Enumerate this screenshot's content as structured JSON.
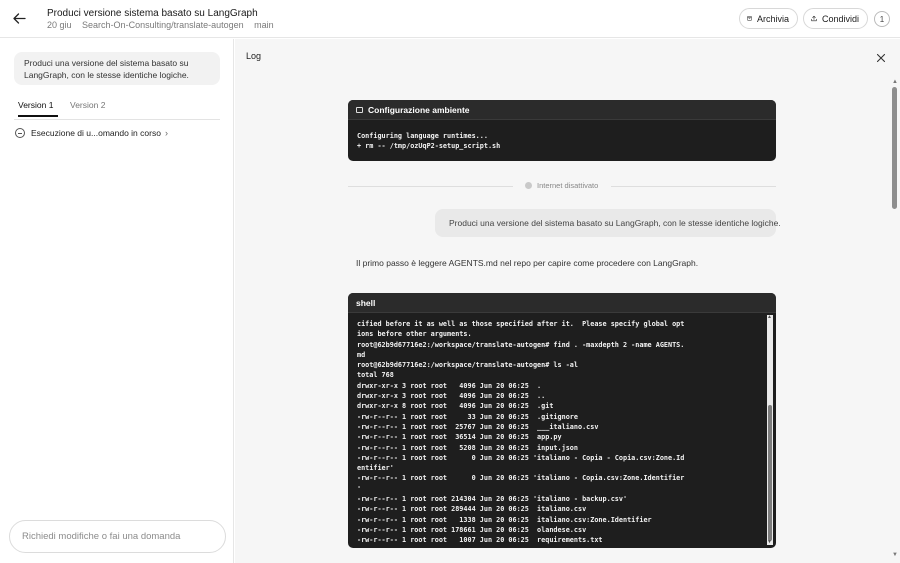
{
  "header": {
    "title": "Produci versione sistema basato su LangGraph",
    "date": "20 giu",
    "repo": "Search-On-Consulting/translate-autogen",
    "branch": "main",
    "archive_label": "Archivia",
    "share_label": "Condividi",
    "more_label": "1"
  },
  "sidebar": {
    "prompt": "Produci una versione del sistema basato su LangGraph, con le stesse identiche logiche.",
    "tabs": [
      {
        "label": "Version 1",
        "active": true
      },
      {
        "label": "Version 2",
        "active": false
      }
    ],
    "task_label": "Esecuzione di u...omando in corso",
    "input_placeholder": "Richiedi modifiche o fai una domanda"
  },
  "log": {
    "title": "Log",
    "config_terminal": {
      "title": "Configurazione ambiente",
      "output": "Configuring language runtimes...\n+ rm -- /tmp/ozUqP2-setup_script.sh"
    },
    "internet_status": "Internet disattivato",
    "user_message": "Produci una versione del sistema basato su LangGraph, con le stesse identiche logiche.",
    "assistant_message": "Il primo passo è leggere AGENTS.md nel repo per capire come procedere con LangGraph.",
    "shell_terminal": {
      "title": "shell",
      "output": "cified before it as well as those specified after it.  Please specify global opt\nions before other arguments.\nroot@62b9d67716e2:/workspace/translate-autogen# find . -maxdepth 2 -name AGENTS.\nmd\nroot@62b9d67716e2:/workspace/translate-autogen# ls -al\ntotal 768\ndrwxr-xr-x 3 root root   4096 Jun 20 06:25  .\ndrwxr-xr-x 3 root root   4096 Jun 20 06:25  ..\ndrwxr-xr-x 8 root root   4096 Jun 20 06:25  .git\n-rw-r--r-- 1 root root     33 Jun 20 06:25  .gitignore\n-rw-r--r-- 1 root root  25767 Jun 20 06:25  ___italiano.csv\n-rw-r--r-- 1 root root  36514 Jun 20 06:25  app.py\n-rw-r--r-- 1 root root   5208 Jun 20 06:25  input.json\n-rw-r--r-- 1 root root      0 Jun 20 06:25 'italiano - Copia - Copia.csv:Zone.Id\nentifier'\n-rw-r--r-- 1 root root      0 Jun 20 06:25 'italiano - Copia.csv:Zone.Identifier\n'\n-rw-r--r-- 1 root root 214304 Jun 20 06:25 'italiano - backup.csv'\n-rw-r--r-- 1 root root 289444 Jun 20 06:25  italiano.csv\n-rw-r--r-- 1 root root   1338 Jun 20 06:25  italiano.csv:Zone.Identifier\n-rw-r--r-- 1 root root 178661 Jun 20 06:25  olandese.csv\n-rw-r--r-- 1 root root   1007 Jun 20 06:25  requirements.txt"
    }
  },
  "icons": {
    "back": "arrow-left-icon",
    "archive": "archive-box-icon",
    "share": "share-upload-icon",
    "close": "close-icon",
    "terminal": "terminal-icon",
    "spinner": "spinner-icon"
  }
}
